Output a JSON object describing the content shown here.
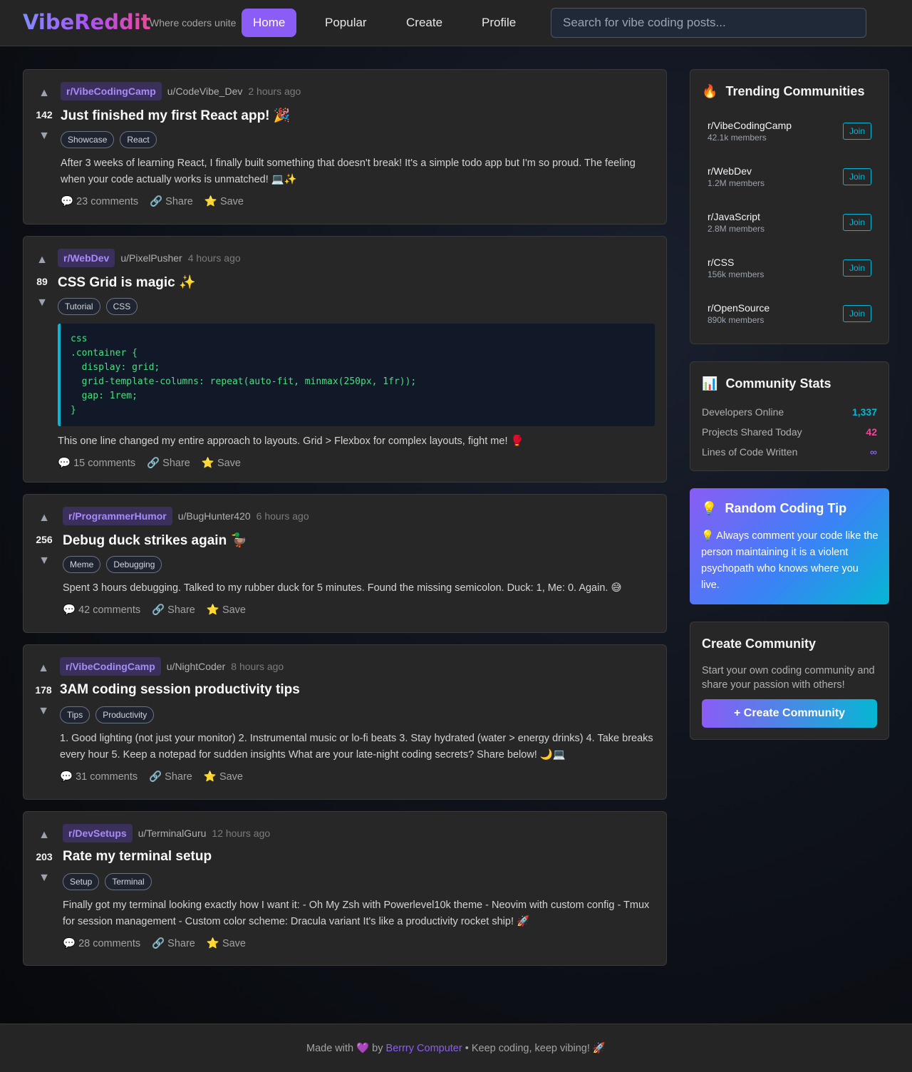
{
  "header": {
    "logo": "VibeReddit",
    "tagline": "Where coders unite",
    "nav": [
      "Home",
      "Popular",
      "Create",
      "Profile"
    ],
    "active_nav": "Home",
    "search_placeholder": "Search for vibe coding posts..."
  },
  "posts": [
    {
      "score": "142",
      "subreddit": "r/VibeCodingCamp",
      "author": "u/CodeVibe_Dev",
      "time": "2 hours ago",
      "title": "Just finished my first React app! 🎉",
      "tags": [
        "Showcase",
        "React"
      ],
      "text": "After 3 weeks of learning React, I finally built something that doesn't break! It's a simple todo app but I'm so proud. The feeling when your code actually works is unmatched! 💻✨",
      "comments": "23 comments",
      "share": "Share",
      "save": "Save"
    },
    {
      "score": "89",
      "subreddit": "r/WebDev",
      "author": "u/PixelPusher",
      "time": "4 hours ago",
      "title": "CSS Grid is magic ✨",
      "tags": [
        "Tutorial",
        "CSS"
      ],
      "code": "css\n.container {\n  display: grid;\n  grid-template-columns: repeat(auto-fit, minmax(250px, 1fr));\n  gap: 1rem;\n}",
      "text": "This one line changed my entire approach to layouts. Grid > Flexbox for complex layouts, fight me! 🥊",
      "comments": "15 comments",
      "share": "Share",
      "save": "Save"
    },
    {
      "score": "256",
      "subreddit": "r/ProgrammerHumor",
      "author": "u/BugHunter420",
      "time": "6 hours ago",
      "title": "Debug duck strikes again 🦆",
      "tags": [
        "Meme",
        "Debugging"
      ],
      "text": "Spent 3 hours debugging. Talked to my rubber duck for 5 minutes. Found the missing semicolon. Duck: 1, Me: 0. Again. 😅",
      "comments": "42 comments",
      "share": "Share",
      "save": "Save"
    },
    {
      "score": "178",
      "subreddit": "r/VibeCodingCamp",
      "author": "u/NightCoder",
      "time": "8 hours ago",
      "title": "3AM coding session productivity tips",
      "tags": [
        "Tips",
        "Productivity"
      ],
      "text": "1. Good lighting (not just your monitor) 2. Instrumental music or lo-fi beats 3. Stay hydrated (water > energy drinks) 4. Take breaks every hour 5. Keep a notepad for sudden insights What are your late-night coding secrets? Share below! 🌙💻",
      "comments": "31 comments",
      "share": "Share",
      "save": "Save"
    },
    {
      "score": "203",
      "subreddit": "r/DevSetups",
      "author": "u/TerminalGuru",
      "time": "12 hours ago",
      "title": "Rate my terminal setup",
      "tags": [
        "Setup",
        "Terminal"
      ],
      "text": "Finally got my terminal looking exactly how I want it: - Oh My Zsh with Powerlevel10k theme - Neovim with custom config - Tmux for session management - Custom color scheme: Dracula variant It's like a productivity rocket ship! 🚀",
      "comments": "28 comments",
      "share": "Share",
      "save": "Save"
    }
  ],
  "trending": {
    "title": "Trending Communities",
    "icon": "🔥",
    "join_label": "Join",
    "communities": [
      {
        "name": "r/VibeCodingCamp",
        "members": "42.1k members"
      },
      {
        "name": "r/WebDev",
        "members": "1.2M members"
      },
      {
        "name": "r/JavaScript",
        "members": "2.8M members"
      },
      {
        "name": "r/CSS",
        "members": "156k members"
      },
      {
        "name": "r/OpenSource",
        "members": "890k members"
      }
    ]
  },
  "stats": {
    "title": "Community Stats",
    "icon": "📊",
    "rows": [
      {
        "label": "Developers Online",
        "value": "1,337",
        "color": "#06b6d4"
      },
      {
        "label": "Projects Shared Today",
        "value": "42",
        "color": "#ec4899"
      },
      {
        "label": "Lines of Code Written",
        "value": "∞",
        "color": "#8b5cf6"
      }
    ]
  },
  "tip": {
    "icon": "💡",
    "title": "Random Coding Tip",
    "text": "💡 Always comment your code like the person maintaining it is a violent psychopath who knows where you live."
  },
  "create": {
    "title": "Create Community",
    "text": "Start your own coding community and share your passion with others!",
    "button": "+ Create Community"
  },
  "footer": {
    "prefix": "Made with 💜 by",
    "link": "Berrry Computer",
    "suffix": "• Keep coding, keep vibing! 🚀"
  },
  "icons": {
    "upvote": "arrow-up-icon",
    "downvote": "arrow-down-icon",
    "comments": "speech-bubble-icon",
    "share": "link-icon",
    "save": "star-icon"
  }
}
